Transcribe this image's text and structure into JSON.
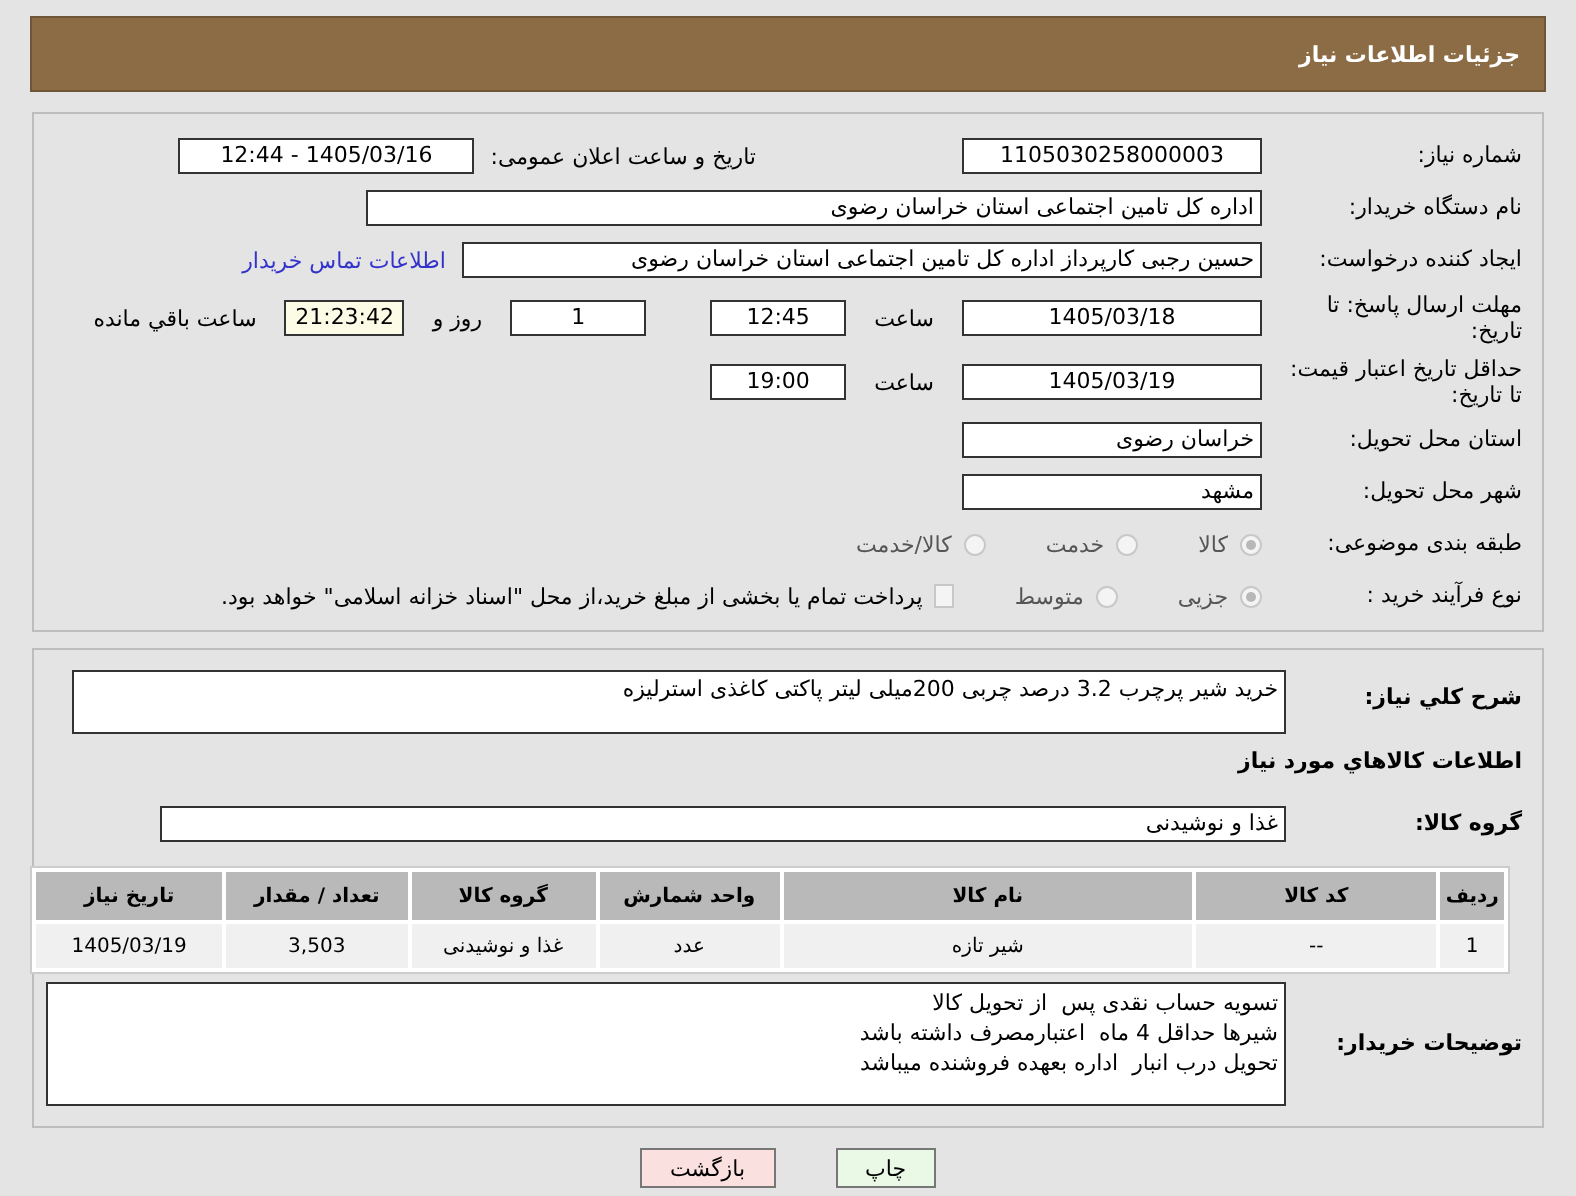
{
  "header": {
    "title": "جزئیات اطلاعات نیاز"
  },
  "form": {
    "need_number": {
      "label": "شماره نیاز:",
      "value": "1105030258000003"
    },
    "announce": {
      "label": "تاریخ و ساعت اعلان عمومی:",
      "value": "1405/03/16 - 12:44"
    },
    "buyer_org": {
      "label": "نام دستگاه خریدار:",
      "value": "اداره کل تامین اجتماعی استان خراسان رضوی"
    },
    "creator": {
      "label": "ایجاد کننده درخواست:",
      "value": "حسین رجبی کارپرداز اداره کل تامین اجتماعی استان خراسان رضوی",
      "link": "اطلاعات تماس خریدار"
    },
    "deadline": {
      "label": "مهلت ارسال پاسخ: تا تاریخ:",
      "date": "1405/03/18",
      "time_label": "ساعت",
      "time": "12:45",
      "days": "1",
      "days_label": "روز و",
      "remaining": "21:23:42",
      "remaining_label": "ساعت باقي مانده"
    },
    "price_validity": {
      "label": "حداقل تاریخ اعتبار قیمت: تا تاریخ:",
      "date": "1405/03/19",
      "time_label": "ساعت",
      "time": "19:00"
    },
    "province": {
      "label": "استان محل تحویل:",
      "value": "خراسان رضوی"
    },
    "city": {
      "label": "شهر محل تحویل:",
      "value": "مشهد"
    },
    "category": {
      "label": "طبقه بندی موضوعی:",
      "options": [
        {
          "label": "کالا",
          "selected": true
        },
        {
          "label": "خدمت",
          "selected": false
        },
        {
          "label": "کالا/خدمت",
          "selected": false
        }
      ]
    },
    "purchase_type": {
      "label": "نوع فرآیند خرید :",
      "options": [
        {
          "label": "جزیی",
          "selected": true
        },
        {
          "label": "متوسط",
          "selected": false
        }
      ],
      "treasury": {
        "label": "پرداخت تمام یا بخشی از مبلغ خرید،از محل \"اسناد خزانه اسلامی\" خواهد بود.",
        "checked": false
      }
    }
  },
  "details": {
    "description": {
      "label": "شرح کلي نیاز:",
      "value": "خرید شیر پرچرب 3.2 درصد چربی 200میلی لیتر پاکتی کاغذی استرلیزه"
    },
    "goods_heading": "اطلاعات کالاهاي مورد نیاز",
    "goods_group": {
      "label": "گروه کالا:",
      "value": "غذا و نوشیدنی"
    },
    "table": {
      "columns": [
        "ردیف",
        "کد کالا",
        "نام کالا",
        "واحد شمارش",
        "گروه کالا",
        "تعداد / مقدار",
        "تاریخ نیاز"
      ],
      "rows": [
        [
          "1",
          "--",
          "شیر تازه",
          "عدد",
          "غذا و نوشیدنی",
          "3,503",
          "1405/03/19"
        ]
      ]
    },
    "buyer_notes": {
      "label": "توضیحات خریدار:",
      "lines": [
        "تسویه حساب نقدی پس  از تحویل کالا",
        "شیرها حداقل 4 ماه  اعتبارمصرف داشته باشد",
        "تحویل درب انبار  اداره بعهده فروشنده میباشد"
      ]
    }
  },
  "buttons": [
    {
      "kind": "print",
      "label": "چاپ"
    },
    {
      "kind": "back",
      "label": "بازگشت"
    }
  ]
}
